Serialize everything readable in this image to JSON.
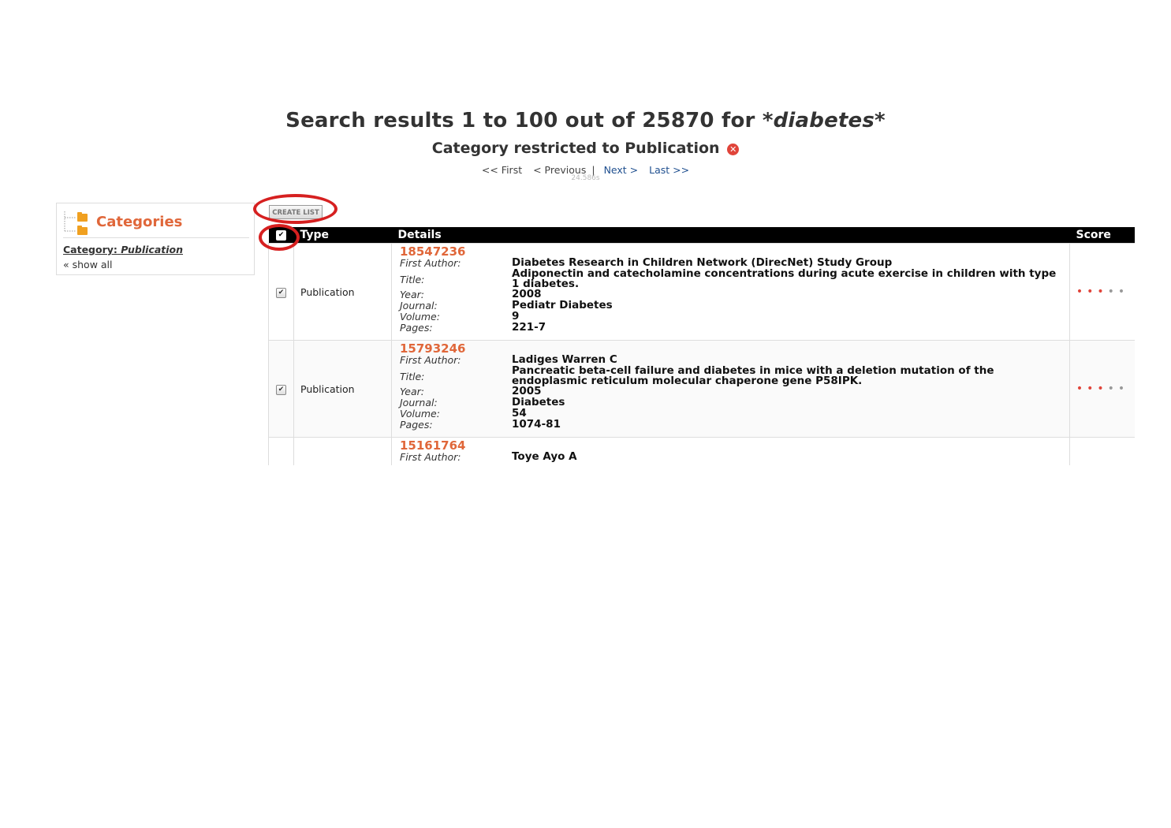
{
  "header": {
    "title_prefix": "Search results 1 to 100 out of 25870 for",
    "query": "*diabetes*",
    "subtitle": "Category restricted to Publication",
    "remove_icon": "remove-filter-icon"
  },
  "pager": {
    "first": "<< First",
    "previous": "< Previous",
    "separator": "|",
    "next": "Next >",
    "last": "Last >>",
    "timing": "24.586s"
  },
  "sidebar": {
    "title": "Categories",
    "current_label": "Category:",
    "current_value": "Publication",
    "show_all": "« show all",
    "icon": "folder-tree-icon"
  },
  "toolbar": {
    "create_list": "CREATE LIST"
  },
  "table": {
    "headers": {
      "type": "Type",
      "details": "Details",
      "score": "Score"
    },
    "field_labels": {
      "first_author": "First Author:",
      "title": "Title:",
      "year": "Year:",
      "journal": "Journal:",
      "volume": "Volume:",
      "pages": "Pages:"
    },
    "rows": [
      {
        "checked": true,
        "type": "Publication",
        "pmid": "18547236",
        "first_author": "Diabetes Research in Children Network (DirecNet) Study Group",
        "title": "Adiponectin and catecholamine concentrations during acute exercise in children with type 1 diabetes.",
        "year": "2008",
        "journal": "Pediatr Diabetes",
        "volume": "9",
        "pages": "221-7",
        "score": 3,
        "score_max": 5
      },
      {
        "checked": true,
        "type": "Publication",
        "pmid": "15793246",
        "first_author": "Ladiges Warren C",
        "title": "Pancreatic beta-cell failure and diabetes in mice with a deletion mutation of the endoplasmic reticulum molecular chaperone gene P58IPK.",
        "year": "2005",
        "journal": "Diabetes",
        "volume": "54",
        "pages": "1074-81",
        "score": 3,
        "score_max": 5
      },
      {
        "checked": false,
        "type": "",
        "pmid": "15161764",
        "first_author": "Toye Ayo A"
      }
    ]
  },
  "colors": {
    "accent": "#e0673a",
    "highlight_ring": "#d62020",
    "link": "#1f4f8f",
    "score_filled": "#e0443a",
    "score_empty": "#999999"
  }
}
